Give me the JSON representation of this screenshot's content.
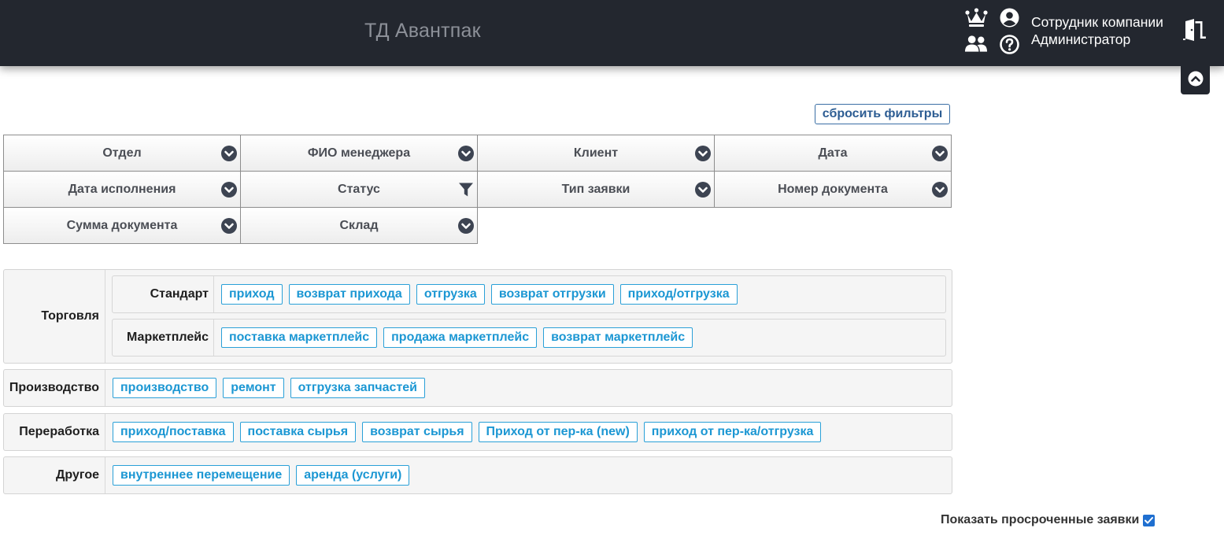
{
  "header": {
    "brand": "ТД Авантпак",
    "user_role": "Сотрудник компании",
    "user_name": "Администратор",
    "icons": [
      "crown-icon",
      "user-circle-icon",
      "users-icon",
      "question-circle-icon",
      "logout-door-icon",
      "chevron-up-circle-icon"
    ]
  },
  "colors": {
    "topbar": "#23272f",
    "chip_border": "#2aa0d8",
    "chip_text": "#1c97d3",
    "reset_border": "#3a6ea5",
    "checkbox": "#1f6fd0"
  },
  "toolbar": {
    "reset_filters_label": "сбросить фильтры"
  },
  "filters": {
    "rows": [
      [
        {
          "label": "Отдел",
          "icon": "chevron-down-circle-icon"
        },
        {
          "label": "ФИО менеджера",
          "icon": "chevron-down-circle-icon"
        },
        {
          "label": "Клиент",
          "icon": "chevron-down-circle-icon"
        },
        {
          "label": "Дата",
          "icon": "chevron-down-circle-icon"
        }
      ],
      [
        {
          "label": "Дата исполнения",
          "icon": "chevron-down-circle-icon"
        },
        {
          "label": "Статус",
          "icon": "filter-icon"
        },
        {
          "label": "Тип заявки",
          "icon": "chevron-down-circle-icon"
        },
        {
          "label": "Номер документа",
          "icon": "chevron-down-circle-icon"
        }
      ],
      [
        {
          "label": "Сумма документа",
          "icon": "chevron-down-circle-icon"
        },
        {
          "label": "Склад",
          "icon": "chevron-down-circle-icon"
        }
      ]
    ]
  },
  "groups": {
    "trade": {
      "title": "Торговля",
      "standard": {
        "title": "Стандарт",
        "chips": [
          "приход",
          "возврат прихода",
          "отгрузка",
          "возврат отгрузки",
          "приход/отгрузка"
        ]
      },
      "marketplace": {
        "title": "Маркетплейс",
        "chips": [
          "поставка маркетплейс",
          "продажа маркетплейс",
          "возврат маркетплейс"
        ]
      }
    },
    "production": {
      "title": "Производство",
      "chips": [
        "производство",
        "ремонт",
        "отгрузка запчастей"
      ]
    },
    "processing": {
      "title": "Переработка",
      "chips": [
        "приход/поставка",
        "поставка сырья",
        "возврат сырья",
        "Приход от пер-ка (new)",
        "приход от пер-ка/отгрузка"
      ]
    },
    "other": {
      "title": "Другое",
      "chips": [
        "внутреннее перемещение",
        "аренда (услуги)"
      ]
    }
  },
  "overdue": {
    "label": "Показать просроченные заявки",
    "checked": true
  }
}
